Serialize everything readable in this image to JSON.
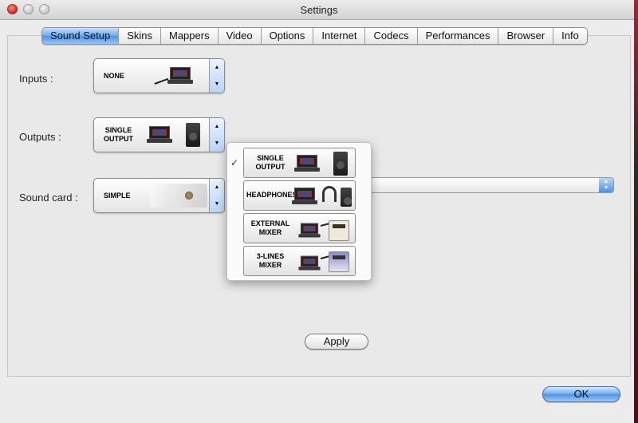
{
  "window": {
    "title": "Settings"
  },
  "tabs": [
    "Sound Setup",
    "Skins",
    "Mappers",
    "Video",
    "Options",
    "Internet",
    "Codecs",
    "Performances",
    "Browser",
    "Info"
  ],
  "active_tab": "Sound Setup",
  "inputs": {
    "label": "Inputs :",
    "value": "NONE"
  },
  "outputs": {
    "label": "Outputs :",
    "value_line1": "SINGLE",
    "value_line2": "OUTPUT"
  },
  "soundcard": {
    "label": "Sound card :",
    "value": "SIMPLE"
  },
  "outputs_menu": {
    "items": [
      {
        "line1": "SINGLE",
        "line2": "OUTPUT",
        "checked": true
      },
      {
        "line1": "HEADPHONES",
        "line2": "",
        "checked": false
      },
      {
        "line1": "EXTERNAL",
        "line2": "MIXER",
        "checked": false
      },
      {
        "line1": "3-LINES",
        "line2": "MIXER",
        "checked": false
      }
    ],
    "check_glyph": "✓"
  },
  "buttons": {
    "apply": "Apply",
    "ok": "OK"
  },
  "stepper": {
    "up": "▲",
    "down": "▼"
  },
  "icons": [
    "close-icon",
    "minimize-icon",
    "zoom-icon",
    "laptop-icon",
    "speaker-icon",
    "headphones-icon",
    "mixer-icon",
    "soundcard-icon",
    "stepper-arrows-icon",
    "checkmark-icon"
  ]
}
